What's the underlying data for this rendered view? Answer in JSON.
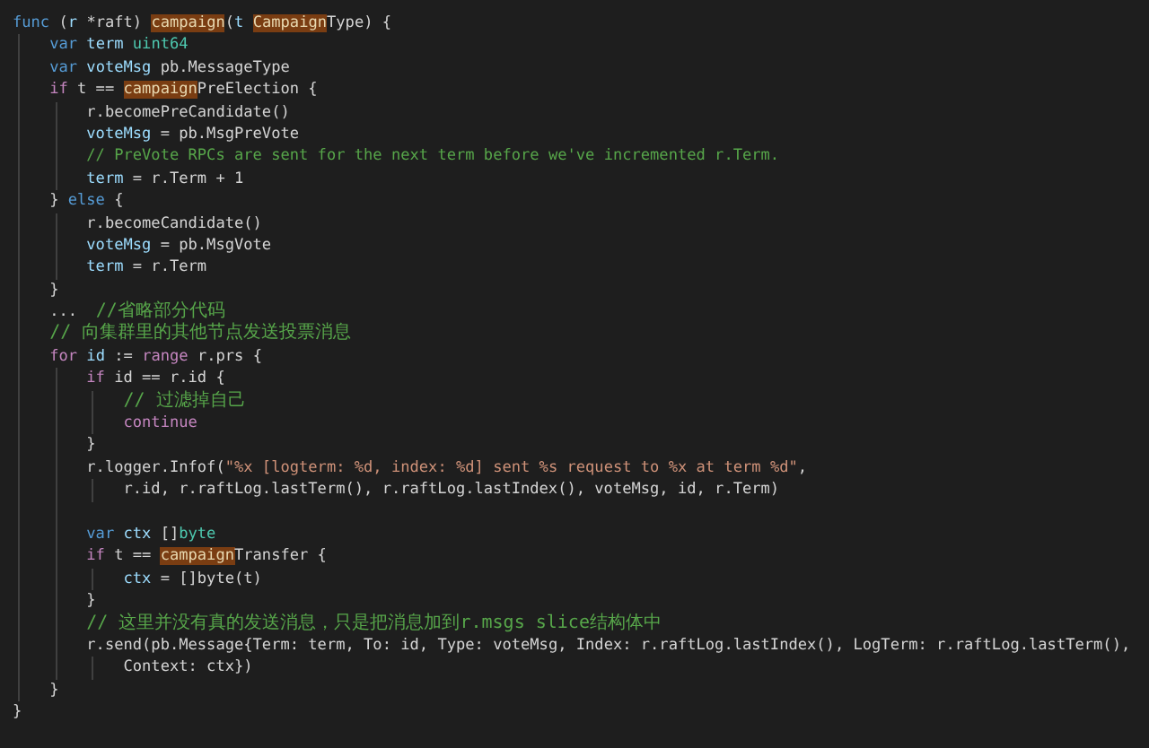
{
  "editor": {
    "lines": [
      {
        "kind": "code",
        "tokens": [
          {
            "kind": "keyword",
            "text": "func"
          },
          {
            "kind": "plain",
            "text": " ("
          },
          {
            "kind": "variable",
            "text": "r"
          },
          {
            "kind": "plain",
            "text": " *raft) "
          },
          {
            "kind": "match",
            "text": "campaign"
          },
          {
            "kind": "plain",
            "text": "("
          },
          {
            "kind": "variable",
            "text": "t "
          },
          {
            "kind": "match",
            "text": "Campaign"
          },
          {
            "kind": "plain",
            "text": "Type) {"
          }
        ],
        "children": [
          {
            "kind": "code",
            "tokens": [
              {
                "kind": "keyword",
                "text": "var "
              },
              {
                "kind": "variable",
                "text": "term "
              },
              {
                "kind": "type",
                "text": "uint64"
              }
            ]
          },
          {
            "kind": "code",
            "tokens": [
              {
                "kind": "keyword",
                "text": "var "
              },
              {
                "kind": "variable",
                "text": "voteMsg"
              },
              {
                "kind": "plain",
                "text": " pb.MessageType"
              }
            ]
          },
          {
            "kind": "code",
            "tokens": [
              {
                "kind": "control",
                "text": "if"
              },
              {
                "kind": "plain",
                "text": " t == "
              },
              {
                "kind": "match",
                "text": "campaign"
              },
              {
                "kind": "plain",
                "text": "PreElection {"
              }
            ],
            "children": [
              {
                "kind": "code",
                "tokens": [
                  {
                    "kind": "plain",
                    "text": "r.becomePreCandidate()"
                  }
                ]
              },
              {
                "kind": "code",
                "tokens": [
                  {
                    "kind": "variable",
                    "text": "voteMsg"
                  },
                  {
                    "kind": "plain",
                    "text": " = pb.MsgPreVote"
                  }
                ]
              },
              {
                "kind": "code",
                "tokens": [
                  {
                    "kind": "comment",
                    "text": "// PreVote RPCs are sent for the next term before we've incremented r.Term."
                  }
                ]
              },
              {
                "kind": "code",
                "tokens": [
                  {
                    "kind": "variable",
                    "text": "term"
                  },
                  {
                    "kind": "plain",
                    "text": " = r.Term + 1"
                  }
                ]
              }
            ]
          },
          {
            "kind": "code",
            "tokens": [
              {
                "kind": "plain",
                "text": "} "
              },
              {
                "kind": "keyword",
                "text": "else"
              },
              {
                "kind": "plain",
                "text": " {"
              }
            ],
            "children": [
              {
                "kind": "code",
                "tokens": [
                  {
                    "kind": "plain",
                    "text": "r.becomeCandidate()"
                  }
                ]
              },
              {
                "kind": "code",
                "tokens": [
                  {
                    "kind": "variable",
                    "text": "voteMsg"
                  },
                  {
                    "kind": "plain",
                    "text": " = pb.MsgVote"
                  }
                ]
              },
              {
                "kind": "code",
                "tokens": [
                  {
                    "kind": "variable",
                    "text": "term"
                  },
                  {
                    "kind": "plain",
                    "text": " = r.Term"
                  }
                ]
              }
            ]
          },
          {
            "kind": "code",
            "tokens": [
              {
                "kind": "plain",
                "text": "}"
              }
            ]
          },
          {
            "kind": "code",
            "tokens": [
              {
                "kind": "plain",
                "text": "...  "
              },
              {
                "kind": "comment",
                "text": "//省略部分代码"
              }
            ]
          },
          {
            "kind": "code",
            "tokens": [
              {
                "kind": "comment",
                "text": "// 向集群里的其他节点发送投票消息"
              }
            ]
          },
          {
            "kind": "code",
            "tokens": [
              {
                "kind": "control",
                "text": "for "
              },
              {
                "kind": "variable",
                "text": "id"
              },
              {
                "kind": "plain",
                "text": " := "
              },
              {
                "kind": "control",
                "text": "range"
              },
              {
                "kind": "plain",
                "text": " r.prs {"
              }
            ],
            "children": [
              {
                "kind": "code",
                "tokens": [
                  {
                    "kind": "control",
                    "text": "if"
                  },
                  {
                    "kind": "plain",
                    "text": " id == r.id {"
                  }
                ],
                "children": [
                  {
                    "kind": "code",
                    "tokens": [
                      {
                        "kind": "comment",
                        "text": "// 过滤掉自己"
                      }
                    ]
                  },
                  {
                    "kind": "code",
                    "tokens": [
                      {
                        "kind": "control",
                        "text": "continue"
                      }
                    ]
                  }
                ]
              },
              {
                "kind": "code",
                "tokens": [
                  {
                    "kind": "plain",
                    "text": "}"
                  }
                ]
              },
              {
                "kind": "code",
                "tokens": [
                  {
                    "kind": "plain",
                    "text": "r.logger.Infof("
                  },
                  {
                    "kind": "string",
                    "text": "\"%x [logterm: %d, index: %d] sent %s request to %x at term %d\""
                  },
                  {
                    "kind": "plain",
                    "text": ","
                  }
                ],
                "children": [
                  {
                    "kind": "code",
                    "tokens": [
                      {
                        "kind": "plain",
                        "text": "r.id, r.raftLog.lastTerm(), r.raftLog.lastIndex(), voteMsg, id, r.Term)"
                      }
                    ]
                  }
                ]
              },
              {
                "kind": "blank"
              },
              {
                "kind": "code",
                "tokens": [
                  {
                    "kind": "keyword",
                    "text": "var "
                  },
                  {
                    "kind": "variable",
                    "text": "ctx"
                  },
                  {
                    "kind": "plain",
                    "text": " []"
                  },
                  {
                    "kind": "type",
                    "text": "byte"
                  }
                ]
              },
              {
                "kind": "code",
                "tokens": [
                  {
                    "kind": "control",
                    "text": "if"
                  },
                  {
                    "kind": "plain",
                    "text": " t == "
                  },
                  {
                    "kind": "match",
                    "text": "campaign"
                  },
                  {
                    "kind": "plain",
                    "text": "Transfer {"
                  }
                ],
                "children": [
                  {
                    "kind": "code",
                    "tokens": [
                      {
                        "kind": "variable",
                        "text": "ctx"
                      },
                      {
                        "kind": "plain",
                        "text": " = []byte(t)"
                      }
                    ]
                  }
                ]
              },
              {
                "kind": "code",
                "tokens": [
                  {
                    "kind": "plain",
                    "text": "}"
                  }
                ]
              },
              {
                "kind": "code",
                "tokens": [
                  {
                    "kind": "comment",
                    "text": "// 这里并没有真的发送消息，只是把消息加到r.msgs slice结构体中"
                  }
                ]
              },
              {
                "kind": "code",
                "tokens": [
                  {
                    "kind": "plain",
                    "text": "r.send(pb.Message{Term: term, To: id, Type: voteMsg, Index: r.raftLog.lastIndex(), LogTerm: r.raftLog.lastTerm(),"
                  }
                ],
                "children": [
                  {
                    "kind": "code",
                    "tokens": [
                      {
                        "kind": "plain",
                        "text": "Context: ctx})"
                      }
                    ]
                  }
                ]
              }
            ]
          },
          {
            "kind": "code",
            "tokens": [
              {
                "kind": "plain",
                "text": "}"
              }
            ]
          }
        ]
      },
      {
        "kind": "code",
        "tokens": [
          {
            "kind": "plain",
            "text": "}"
          }
        ]
      }
    ]
  }
}
